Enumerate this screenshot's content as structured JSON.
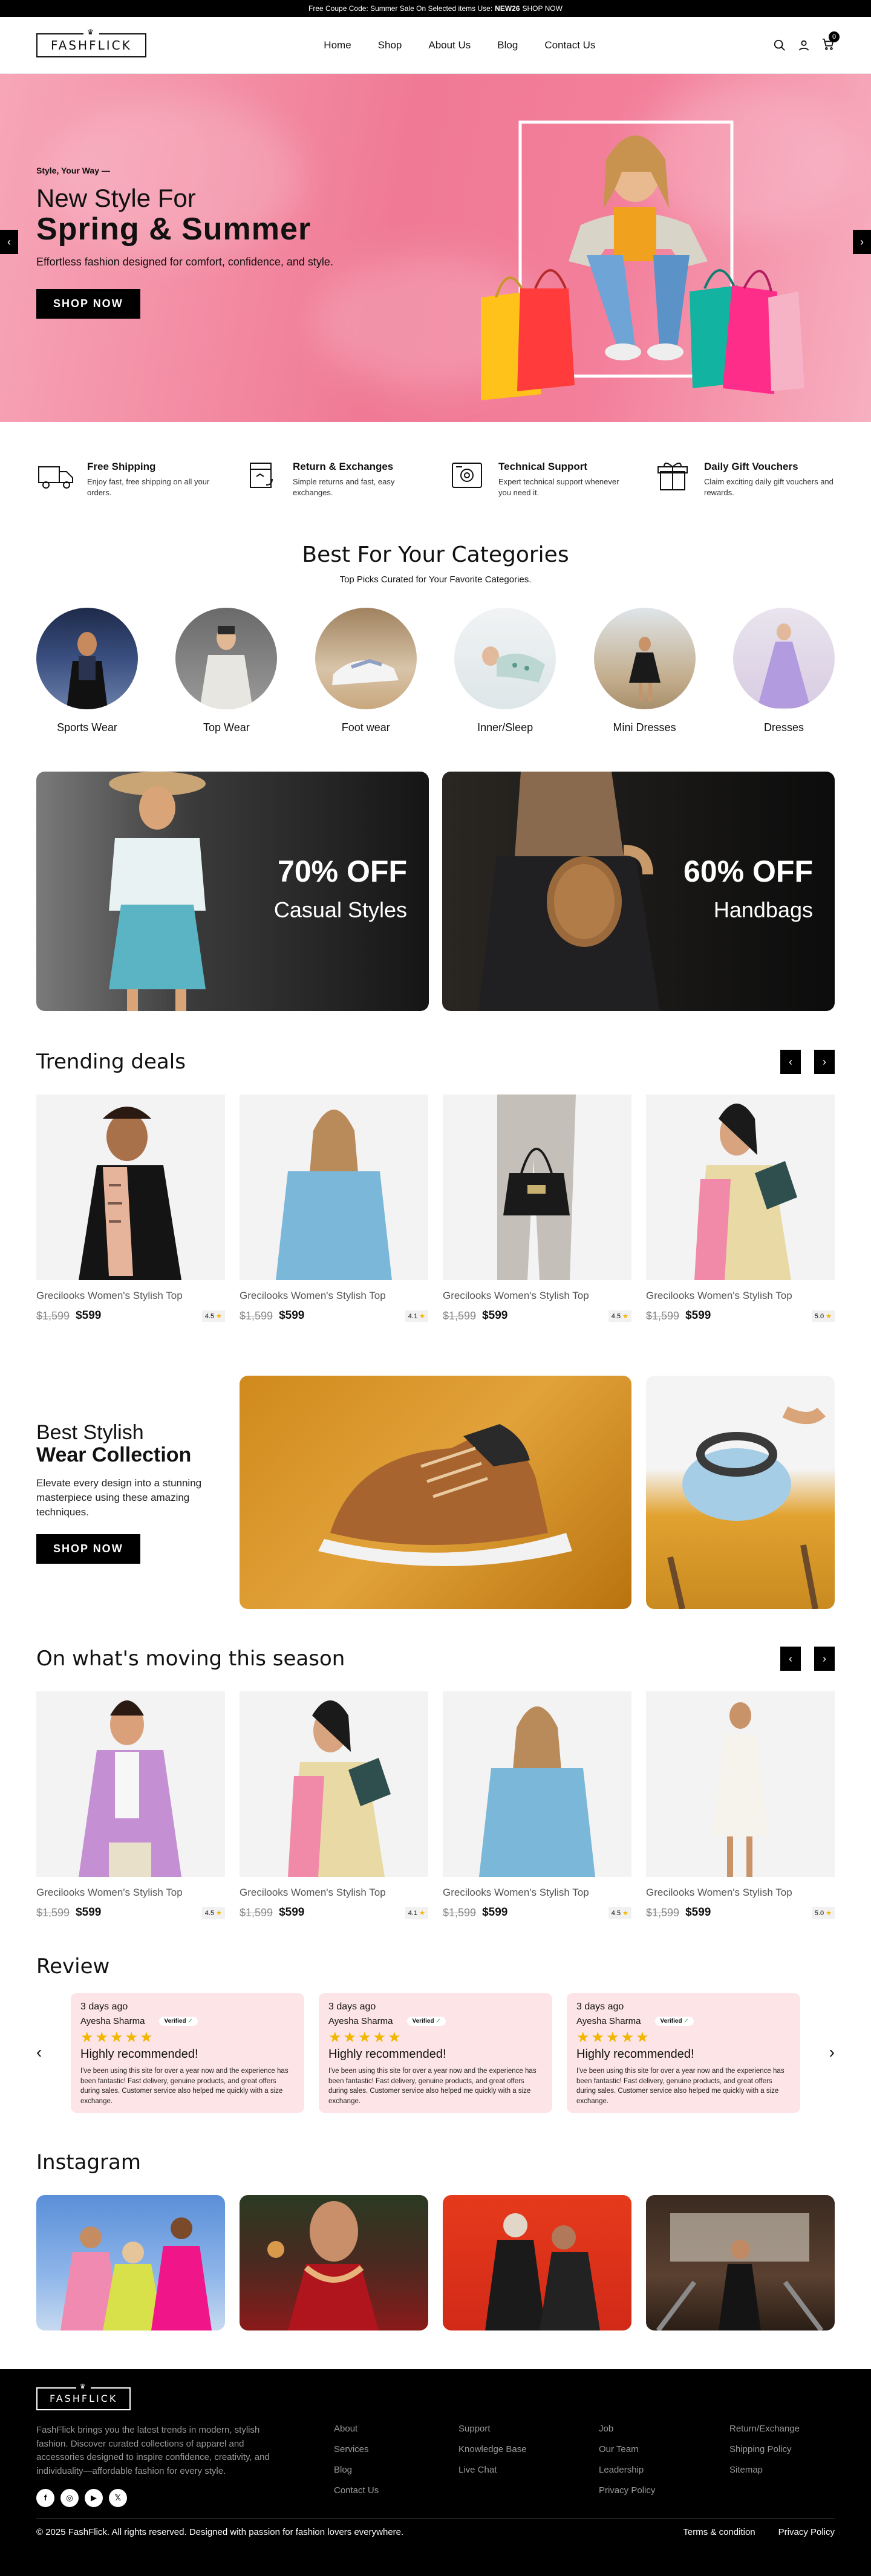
{
  "topbar": {
    "pre": "Free Coupe Code: Summer Sale On Selected items Use:",
    "code": "NEW26",
    "cta": "SHOP NOW"
  },
  "header": {
    "logo": "FASHFLICK",
    "nav": [
      "Home",
      "Shop",
      "About Us",
      "Blog",
      "Contact Us"
    ],
    "cart_count": "0"
  },
  "hero": {
    "kicker": "Style, Your Way —",
    "line1": "New Style For",
    "line2": "Spring & Summer",
    "sub": "Effortless fashion designed for comfort, confidence, and style.",
    "cta": "SHOP NOW"
  },
  "features": [
    {
      "icon": "truck-icon",
      "title": "Free Shipping",
      "text": "Enjoy fast, free shipping on all your orders."
    },
    {
      "icon": "exchange-box-icon",
      "title": "Return & Exchanges",
      "text": "Simple returns and fast, easy exchanges."
    },
    {
      "icon": "support-icon",
      "title": "Technical Support",
      "text": "Expert technical support whenever you need it."
    },
    {
      "icon": "gift-icon",
      "title": "Daily Gift Vouchers",
      "text": "Claim exciting daily gift vouchers and rewards."
    }
  ],
  "categories": {
    "title": "Best For Your Categories",
    "subtitle": "Top Picks Curated for Your Favorite Categories.",
    "items": [
      "Sports Wear",
      "Top Wear",
      "Foot wear",
      "Inner/Sleep",
      "Mini Dresses",
      "Dresses"
    ]
  },
  "promos": [
    {
      "big": "70% OFF",
      "small": "Casual Styles"
    },
    {
      "big": "60% OFF",
      "small": "Handbags"
    }
  ],
  "trending": {
    "title": "Trending deals",
    "products": [
      {
        "name": "Grecilooks Women's Stylish Top",
        "old": "$1,599",
        "price": "$599",
        "rating": "4.5"
      },
      {
        "name": "Grecilooks Women's Stylish Top",
        "old": "$1,599",
        "price": "$599",
        "rating": "4.1"
      },
      {
        "name": "Grecilooks Women's Stylish Top",
        "old": "$1,599",
        "price": "$599",
        "rating": "4.5"
      },
      {
        "name": "Grecilooks Women's Stylish Top",
        "old": "$1,599",
        "price": "$599",
        "rating": "5.0"
      }
    ]
  },
  "collection": {
    "line1": "Best Stylish",
    "line2": "Wear Collection",
    "text": "Elevate every design into a stunning masterpiece using these amazing techniques.",
    "cta": "SHOP NOW"
  },
  "season": {
    "title": "On what's moving this season",
    "products": [
      {
        "name": "Grecilooks Women's Stylish Top",
        "old": "$1,599",
        "price": "$599",
        "rating": "4.5"
      },
      {
        "name": "Grecilooks Women's Stylish Top",
        "old": "$1,599",
        "price": "$599",
        "rating": "4.1"
      },
      {
        "name": "Grecilooks Women's Stylish Top",
        "old": "$1,599",
        "price": "$599",
        "rating": "4.5"
      },
      {
        "name": "Grecilooks Women's Stylish Top",
        "old": "$1,599",
        "price": "$599",
        "rating": "5.0"
      }
    ]
  },
  "reviews": {
    "title": "Review",
    "items": [
      {
        "date": "3 days ago",
        "name": "Ayesha Sharma",
        "badge": "Verified",
        "stars": "★★★★★",
        "headline": "Highly recommended!",
        "body": "I've been using this site for over a year now and the experience has been fantastic! Fast delivery, genuine products, and great offers during sales. Customer service also helped me quickly with a size exchange."
      },
      {
        "date": "3 days ago",
        "name": "Ayesha Sharma",
        "badge": "Verified",
        "stars": "★★★★★",
        "headline": "Highly recommended!",
        "body": "I've been using this site for over a year now and the experience has been fantastic! Fast delivery, genuine products, and great offers during sales. Customer service also helped me quickly with a size exchange."
      },
      {
        "date": "3 days ago",
        "name": "Ayesha Sharma",
        "badge": "Verified",
        "stars": "★★★★★",
        "headline": "Highly recommended!",
        "body": "I've been using this site for over a year now and the experience has been fantastic! Fast delivery, genuine products, and great offers during sales. Customer service also helped me quickly with a size exchange."
      }
    ]
  },
  "instagram": {
    "title": "Instagram"
  },
  "footer": {
    "logo": "FASHFLICK",
    "about": "FashFlick brings you the latest trends in modern, stylish fashion. Discover curated collections of apparel and accessories designed to inspire confidence, creativity, and individuality—affordable fashion for every style.",
    "social": [
      "f",
      "◎",
      "▶",
      "𝕏"
    ],
    "col1": [
      "About",
      "Services",
      "Blog",
      "Contact Us"
    ],
    "col2": [
      "Support",
      "Knowledge Base",
      "Live Chat"
    ],
    "col3": [
      "Job",
      "Our Team",
      "Leadership",
      "Privacy Policy"
    ],
    "col4": [
      "Return/Exchange",
      "Shipping Policy",
      "Sitemap"
    ],
    "copyright": "© 2025 FashFlick. All rights reserved. Designed with passion for fashion lovers everywhere.",
    "bottom_links": [
      "Terms & condition",
      "Privacy Policy"
    ]
  },
  "colors": {
    "hero_pink": "#f07a95",
    "review_pink": "#fde4e6",
    "star": "#f2b600",
    "dark": "#000000"
  }
}
